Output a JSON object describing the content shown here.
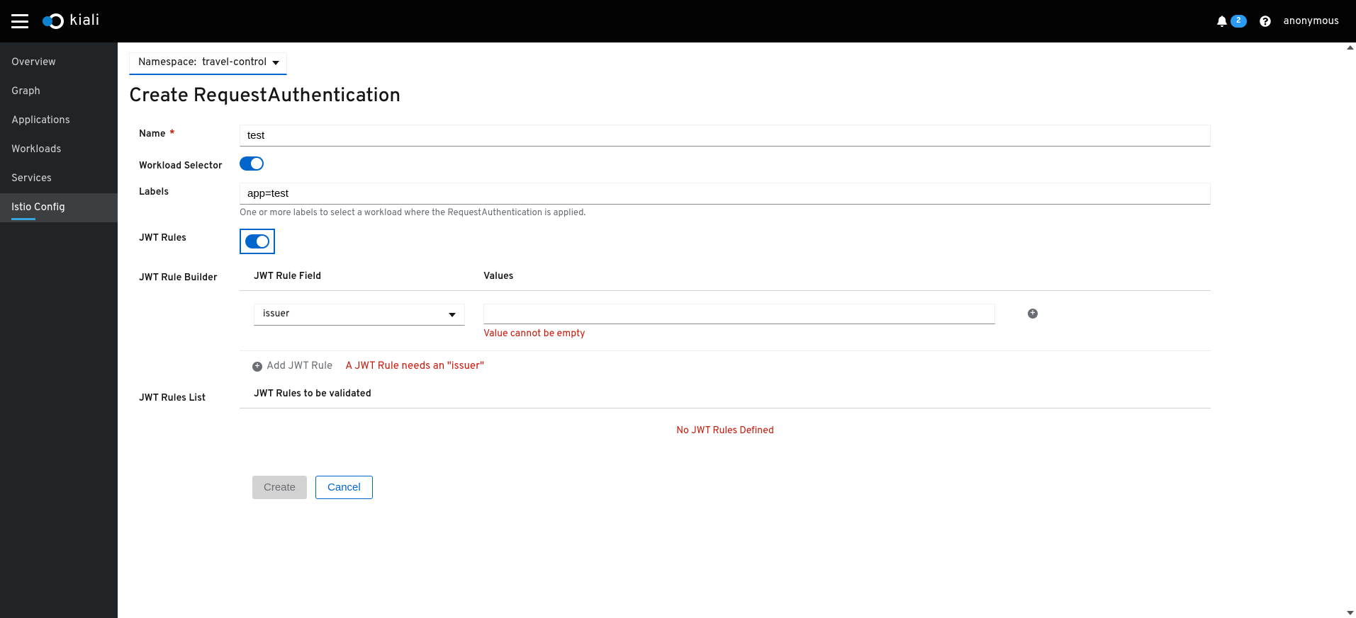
{
  "header": {
    "brand": "kiali",
    "notifications": "2",
    "user": "anonymous"
  },
  "sidebar": {
    "items": [
      {
        "label": "Overview"
      },
      {
        "label": "Graph"
      },
      {
        "label": "Applications"
      },
      {
        "label": "Workloads"
      },
      {
        "label": "Services"
      },
      {
        "label": "Istio Config"
      }
    ],
    "active_index": 5
  },
  "namespace_selector": {
    "label": "Namespace:",
    "value": "travel-control"
  },
  "page": {
    "title": "Create RequestAuthentication"
  },
  "form": {
    "name_label": "Name",
    "name_value": "test",
    "workload_selector_label": "Workload Selector",
    "labels_label": "Labels",
    "labels_value": "app=test",
    "labels_help": "One or more labels to select a workload where the RequestAuthentication is applied.",
    "jwt_rules_label": "JWT Rules",
    "builder_label": "JWT Rule Builder",
    "builder_col_field": "JWT Rule Field",
    "builder_col_values": "Values",
    "field_selected": "issuer",
    "value_input": "",
    "value_error": "Value cannot be empty",
    "add_rule_label": "Add JWT Rule",
    "add_rule_warning": "A JWT Rule needs an \"issuer\"",
    "list_label": "JWT Rules List",
    "list_heading": "JWT Rules to be validated",
    "list_empty": "No JWT Rules Defined"
  },
  "actions": {
    "create": "Create",
    "cancel": "Cancel"
  }
}
